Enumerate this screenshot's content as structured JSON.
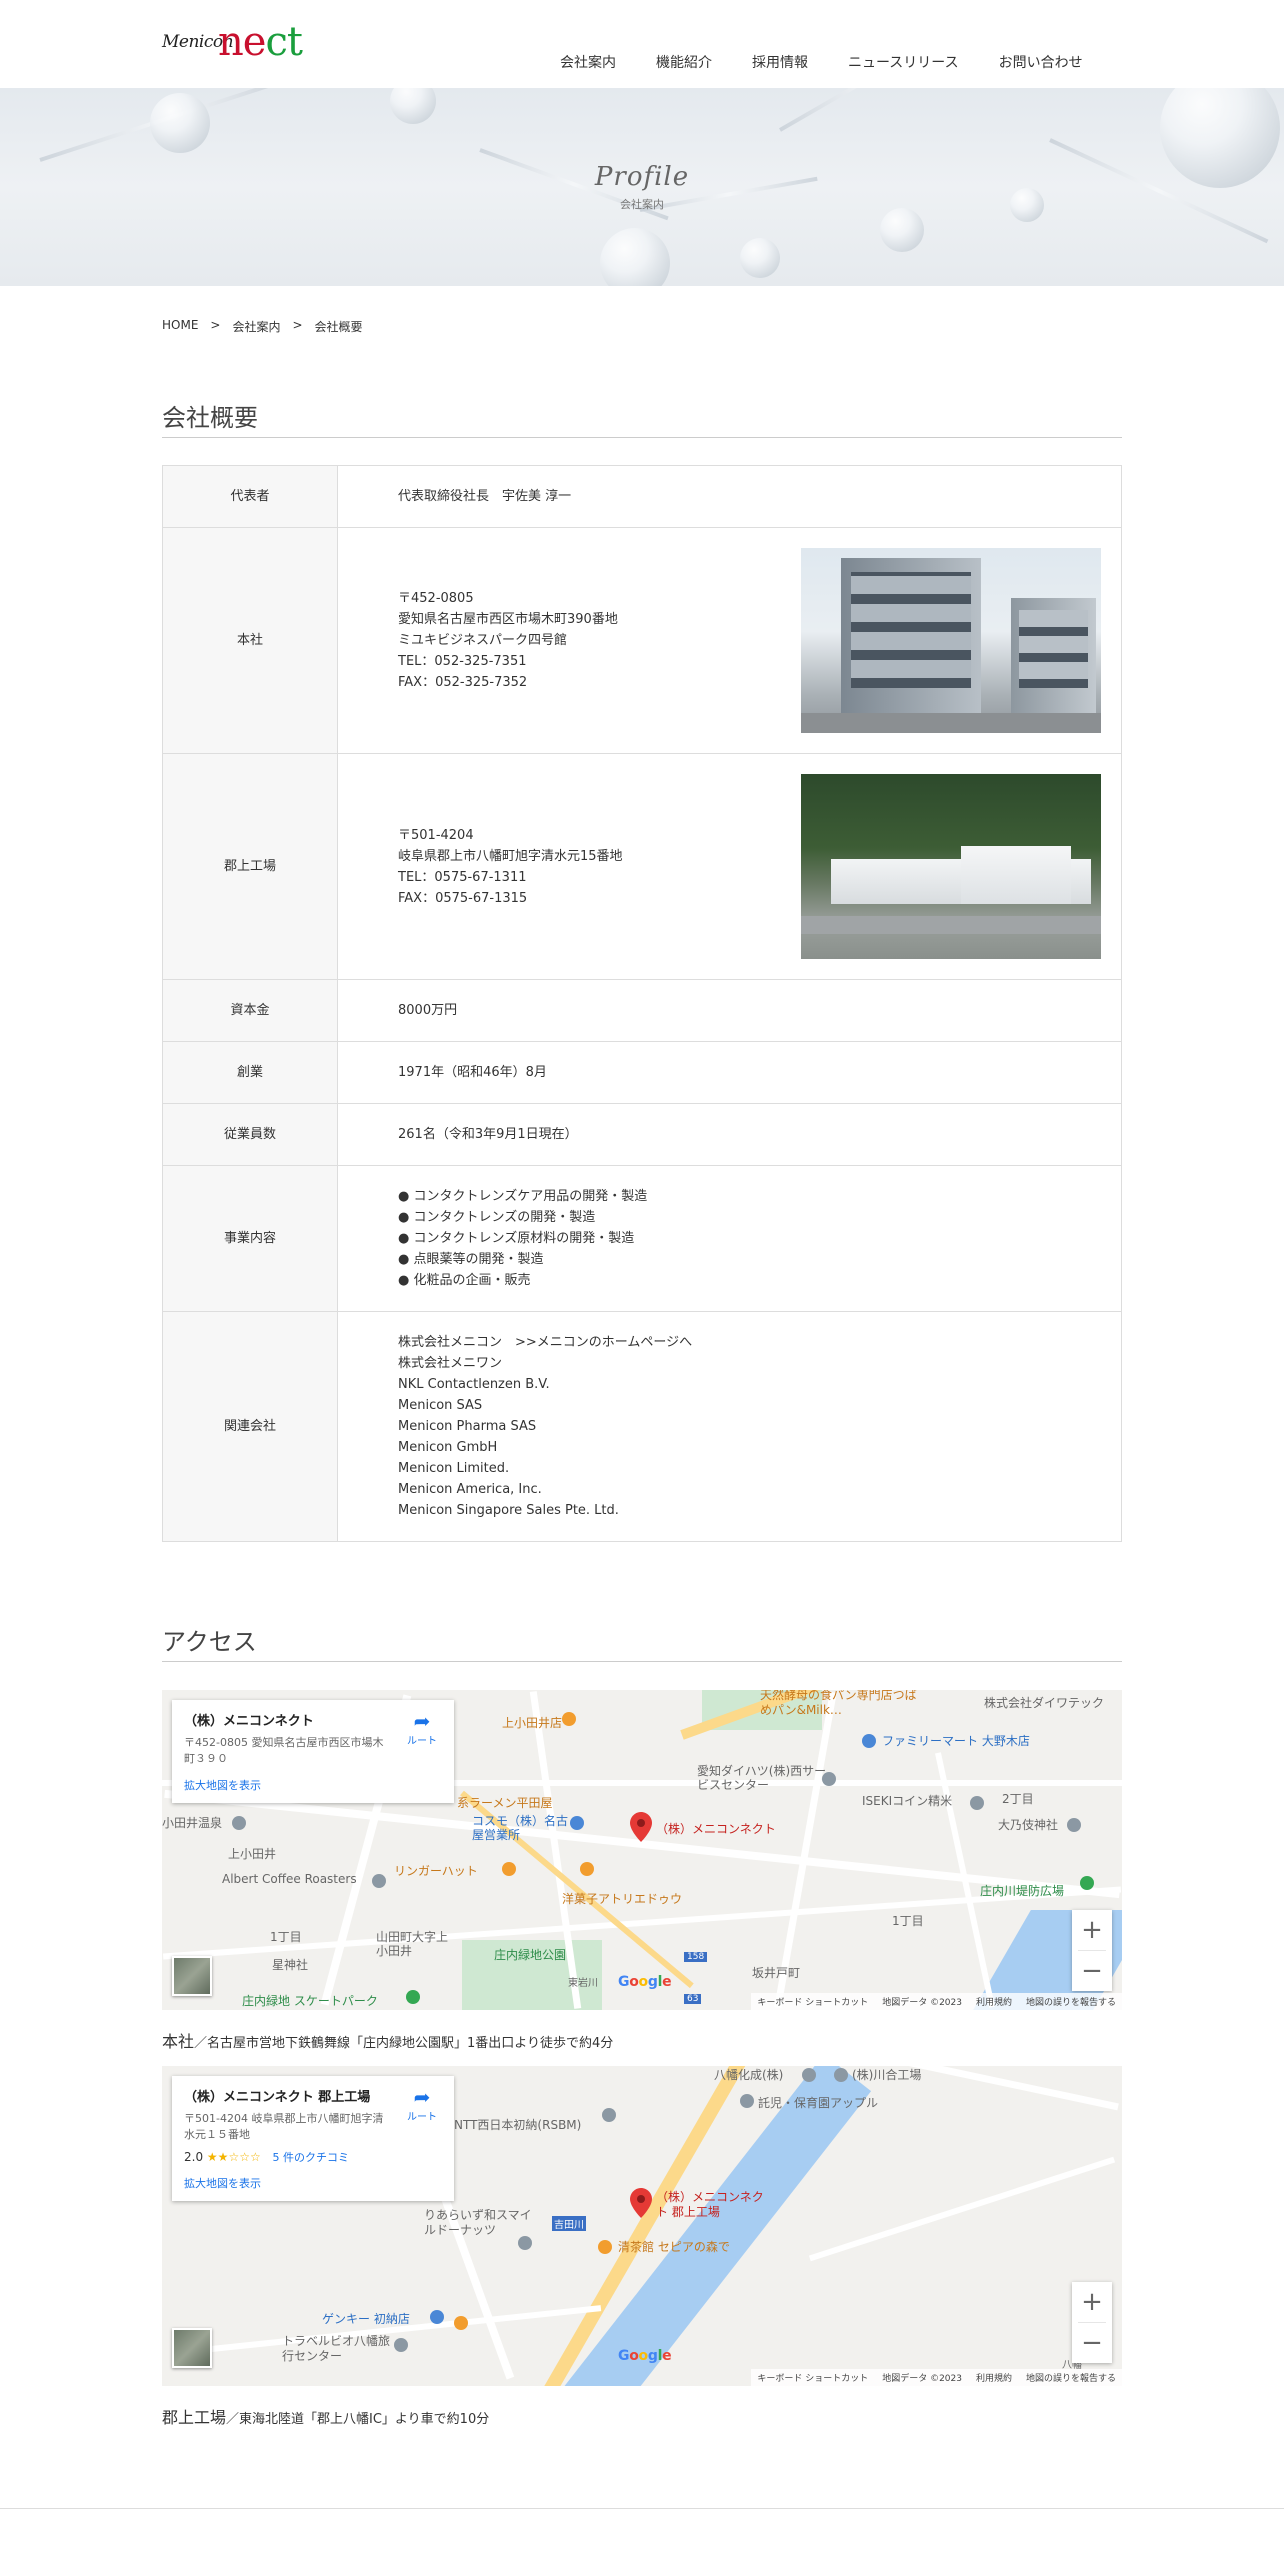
{
  "header": {
    "logo_small": "Menicon",
    "logo_n": "n",
    "logo_e": "e",
    "logo_ct": "ct",
    "nav": [
      "会社案内",
      "機能紹介",
      "採用情報",
      "ニュースリリース",
      "お問い合わせ"
    ]
  },
  "hero": {
    "title": "Profile",
    "subtitle": "会社案内"
  },
  "breadcrumb": {
    "home": "HOME",
    "sep": ">",
    "level1": "会社案内",
    "level2": "会社概要"
  },
  "profile": {
    "heading": "会社概要",
    "rows": [
      {
        "label": "代表者",
        "lines": [
          "代表取締役社長　宇佐美 淳一"
        ]
      },
      {
        "label": "本社",
        "lines": [
          "〒452-0805",
          "愛知県名古屋市西区市場木町390番地",
          "ミユキビジネスパーク四号館",
          "TEL：052-325-7351",
          "FAX：052-325-7352"
        ]
      },
      {
        "label": "郡上工場",
        "lines": [
          "〒501-4204",
          "岐阜県郡上市八幡町旭字清水元15番地",
          "TEL：0575-67-1311",
          "FAX：0575-67-1315"
        ]
      },
      {
        "label": "資本金",
        "lines": [
          "8000万円"
        ]
      },
      {
        "label": "創業",
        "lines": [
          "1971年（昭和46年）8月"
        ]
      },
      {
        "label": "従業員数",
        "lines": [
          "261名（令和3年9月1日現在）"
        ]
      },
      {
        "label": "事業内容",
        "lines": [
          "● コンタクトレンズケア用品の開発・製造",
          "● コンタクトレンズの開発・製造",
          "● コンタクトレンズ原材料の開発・製造",
          "● 点眼薬等の開発・製造",
          "● 化粧品の企画・販売"
        ]
      },
      {
        "label": "関連会社",
        "lines": [
          "株式会社メニコン　>>メニコンのホームページへ",
          "株式会社メニワン",
          "NKL Contactlenzen B.V.",
          "Menicon SAS",
          "Menicon Pharma SAS",
          "Menicon GmbH",
          "Menicon Limited.",
          "Menicon America, Inc.",
          "Menicon Singapore Sales Pte. Ltd."
        ]
      }
    ]
  },
  "access": {
    "heading": "アクセス",
    "map1": {
      "card_title": "（株）メニコンネクト",
      "card_address": "〒452-0805 愛知県名古屋市西区市場木町３９０",
      "card_link": "拡大地図を表示",
      "route": "ルート",
      "pin_label": "（株）メニコンネクト",
      "labels": [
        "天然酵母の食パン専門店つばめパン&Milk…",
        "株式会社ダイワテック",
        "上小田井店",
        "ファミリーマート 大野木店",
        "愛知ダイハツ(株)西サービスセンター",
        "ISEKIコイン精米",
        "大乃伎神社",
        "系ラーメン平田屋",
        "コスモ（株）名古屋営業所",
        "小田井温泉",
        "上小田井",
        "Albert Coffee Roasters",
        "リンガーハット",
        "洋菓子アトリエドゥウ",
        "庄内川堤防広場",
        "1丁目",
        "2丁目",
        "1丁目",
        "山田町大字上小田井",
        "星神社",
        "庄内緑地公園",
        "東岩川",
        "坂井戸町",
        "庄内緑地 スケートパーク",
        "158",
        "63"
      ],
      "attrib": [
        "キーボード ショートカット",
        "地図データ ©2023",
        "利用規約",
        "地図の誤りを報告する"
      ]
    },
    "caption1_main": "本社",
    "caption1_rest": "／名古屋市営地下鉄鶴舞線「庄内緑地公園駅」1番出口より徒歩で約4分",
    "map2": {
      "card_title": "（株）メニコンネクト 郡上工場",
      "card_address": "〒501-4204 岐阜県郡上市八幡町旭字清水元１５番地",
      "rating": "2.0",
      "stars": "★★☆☆☆",
      "reviews": "5 件のクチコミ",
      "card_link": "拡大地図を表示",
      "route": "ルート",
      "pin_label": "（株）メニコンネクト 郡上工場",
      "labels": [
        "八幡化成(株)",
        "(株)川合工場",
        "託児・保育園アップル",
        "NTT西日本初納(RSBM)",
        "りあらいず和スマイルドーナッツ",
        "吉田川",
        "清茶館 セピアの森で",
        "ゲンキー 初納店",
        "トラベルビオ八幡旅行センター",
        "八幡"
      ],
      "attrib": [
        "キーボード ショートカット",
        "地図データ ©2023",
        "利用規約",
        "地図の誤りを報告する"
      ]
    },
    "caption2_main": "郡上工場",
    "caption2_rest": "／東海北陸道「郡上八幡IC」より車で約10分"
  },
  "google_logo": [
    "G",
    "o",
    "o",
    "g",
    "l",
    "e"
  ],
  "colors": {
    "brand_red": "#c8102e",
    "brand_green": "#1a9e3d",
    "map_pin": "#e53935",
    "link_blue": "#1a73e8"
  },
  "icons": [
    "route-icon",
    "map-pin-icon",
    "zoom-in-icon",
    "zoom-out-icon",
    "satellite-toggle-icon"
  ]
}
